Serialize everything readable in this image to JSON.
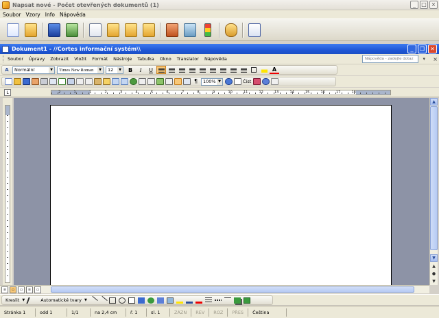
{
  "app": {
    "title": "Napsat nové - Počet otevřených dokumentů (1)",
    "menu": [
      "Soubor",
      "Vzory",
      "Info",
      "Nápověda"
    ]
  },
  "document_window": {
    "title": "Dokument1 - //Cortes informační systém\\\\",
    "menu": [
      "Soubor",
      "Úpravy",
      "Zobrazit",
      "Vložit",
      "Formát",
      "Nástroje",
      "Tabulka",
      "Okno",
      "Translator",
      "Nápověda"
    ],
    "help_placeholder": "Nápověda - zadejte dotaz"
  },
  "formatting": {
    "style": "Normální",
    "font": "Times New Roman",
    "size": "12",
    "bold": "B",
    "italic": "I",
    "underline": "U",
    "font_color_label": "A"
  },
  "standard": {
    "zoom": "100%",
    "read_label": "Číst"
  },
  "drawing": {
    "draw_label": "Kreslit",
    "autoshapes_label": "Automatické tvary"
  },
  "status": {
    "page": "Stránka 1",
    "section": "odd 1",
    "pages": "1/1",
    "at": "na 2,4 cm",
    "line": "ř. 1",
    "column": "sl. 1",
    "rec": "ZÁZN",
    "trk": "REV",
    "ext": "ROZ",
    "ovr": "PŘES",
    "language": "Čeština"
  },
  "ruler": {
    "horizontal_labels": [
      "2",
      "1",
      "1",
      "2",
      "3",
      "4",
      "5",
      "6",
      "7",
      "8",
      "9",
      "10",
      "11",
      "12",
      "13",
      "14",
      "15",
      "16",
      "17",
      "18"
    ]
  },
  "colors": {
    "doc_title_bar": "#1f57d6",
    "workspace": "#8d93a6",
    "toolbar": "#ece9d8"
  }
}
